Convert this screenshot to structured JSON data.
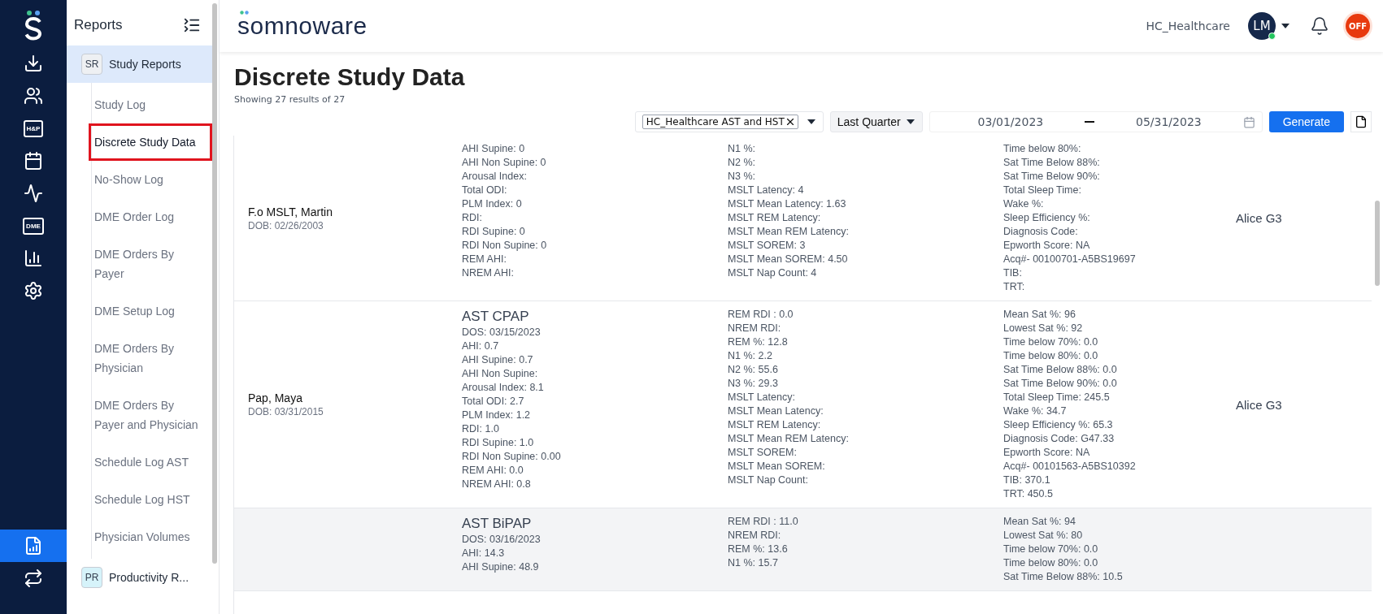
{
  "rail": {
    "items": [
      {
        "kind": "download",
        "selected": false
      },
      {
        "kind": "users",
        "selected": false
      },
      {
        "kind": "tag",
        "label": "H&P",
        "selected": false
      },
      {
        "kind": "calendar",
        "selected": false
      },
      {
        "kind": "activity",
        "selected": false
      },
      {
        "kind": "tag",
        "label": "DME",
        "selected": false
      },
      {
        "kind": "chart",
        "selected": false
      },
      {
        "kind": "settings",
        "selected": false
      }
    ],
    "bottom_items": [
      {
        "kind": "report",
        "selected": true
      },
      {
        "kind": "swap",
        "selected": false
      }
    ]
  },
  "sidebar": {
    "title": "Reports",
    "groups": [
      {
        "badge": "SR",
        "color": "#eef0f3",
        "label": "Study Reports",
        "expanded": true,
        "children": [
          {
            "label": "Study Log",
            "selected": false
          },
          {
            "label": "Discrete Study Data",
            "selected": true
          },
          {
            "label": "No-Show Log",
            "selected": false
          },
          {
            "label": "DME Order Log",
            "selected": false
          },
          {
            "label": "DME Orders By Payer",
            "selected": false
          },
          {
            "label": "DME Setup Log",
            "selected": false
          },
          {
            "label": "DME Orders By Physician",
            "selected": false
          },
          {
            "label": "DME Orders By Payer and Physician",
            "selected": false
          },
          {
            "label": "Schedule Log AST",
            "selected": false
          },
          {
            "label": "Schedule Log HST",
            "selected": false
          },
          {
            "label": "Physician Volumes",
            "selected": false
          }
        ]
      },
      {
        "badge": "PR",
        "color": "#d6f3fa",
        "label": "Productivity R...",
        "expanded": false
      }
    ]
  },
  "header": {
    "logo": "somnoware",
    "organization": "HC_Healthcare",
    "avatar": "LM",
    "online": true,
    "status_badge": "OFF"
  },
  "page": {
    "title": "Discrete Study Data",
    "subtitle": "Showing 27 results of 27"
  },
  "filters": {
    "facility_chip": "HC_Healthcare AST and HST",
    "period": "Last Quarter",
    "date_from": "03/01/2023",
    "date_to": "05/31/2023",
    "generate": "Generate"
  },
  "table": {
    "rows": [
      {
        "name": "F.o MSLT, Martin",
        "dob": "DOB: 02/26/2003",
        "highlighted": false,
        "column_1": [
          "AHI Supine: 0",
          "AHI Non Supine: 0",
          "Arousal Index:",
          "Total ODI:",
          "PLM Index: 0",
          "RDI:",
          "RDI Supine: 0",
          "RDI Non Supine: 0",
          "REM AHI:",
          "NREM AHI:"
        ],
        "column_2": [
          "N1 %:",
          "N2 %:",
          "N3 %:",
          "MSLT Latency: 4",
          "MSLT Mean Latency: 1.63",
          "MSLT REM Latency:",
          "MSLT Mean REM Latency:",
          "MSLT SOREM: 3",
          "MSLT Mean SOREM: 4.50",
          "MSLT Nap Count: 4"
        ],
        "column_3": [
          "Time below 80%:",
          "Sat Time Below 88%:",
          "Sat Time Below 90%:",
          "Total Sleep Time:",
          "Wake %:",
          "Sleep Efficiency %:",
          "Diagnosis Code:",
          "Epworth Score: NA",
          "Acq#- 00100701-A5BS19697",
          "TIB:",
          "TRT:"
        ],
        "device": "Alice G3"
      },
      {
        "name": "Pap, Maya",
        "dob": "DOB: 03/31/2015",
        "highlighted": false,
        "study": "AST CPAP",
        "column_1": [
          "DOS: 03/15/2023",
          "AHI: 0.7",
          "AHI Supine: 0.7",
          "AHI Non Supine:",
          "Arousal Index: 8.1",
          "Total ODI: 2.7",
          "PLM Index: 1.2",
          "RDI: 1.0",
          "RDI Supine: 1.0",
          "RDI Non Supine: 0.00",
          "REM AHI: 0.0",
          "NREM AHI: 0.8"
        ],
        "column_2": [
          "REM RDI : 0.0",
          "NREM RDI:",
          "REM %: 12.8",
          "N1 %: 2.2",
          "N2 %: 55.6",
          "N3 %: 29.3",
          "MSLT Latency:",
          "MSLT Mean Latency:",
          "MSLT REM Latency:",
          "MSLT Mean REM Latency:",
          "MSLT SOREM:",
          "MSLT Mean SOREM:",
          "MSLT Nap Count:"
        ],
        "column_3": [
          "Mean Sat %: 96",
          "Lowest Sat %: 92",
          "Time below 70%: 0.0",
          "Time below 80%: 0.0",
          "Sat Time Below 88%: 0.0",
          "Sat Time Below 90%: 0.0",
          "Total Sleep Time: 245.5",
          "Wake %: 34.7",
          "Sleep Efficiency %: 65.3",
          "Diagnosis Code: G47.33",
          "Epworth Score: NA",
          "Acq#- 00101563-A5BS10392",
          "TIB: 370.1",
          "TRT: 450.5"
        ],
        "device": "Alice G3"
      },
      {
        "highlighted": true,
        "study": "AST BiPAP",
        "column_1": [
          "DOS: 03/16/2023",
          "AHI: 14.3",
          "AHI Supine: 48.9"
        ],
        "column_2": [
          "REM RDI : 11.0",
          "NREM RDI:",
          "REM %: 13.6",
          "N1 %: 15.7"
        ],
        "column_3": [
          "Mean Sat %: 94",
          "Lowest Sat %: 80",
          "Time below 70%: 0.0",
          "Time below 80%: 0.0",
          "Sat Time Below 88%: 10.5"
        ]
      }
    ]
  }
}
